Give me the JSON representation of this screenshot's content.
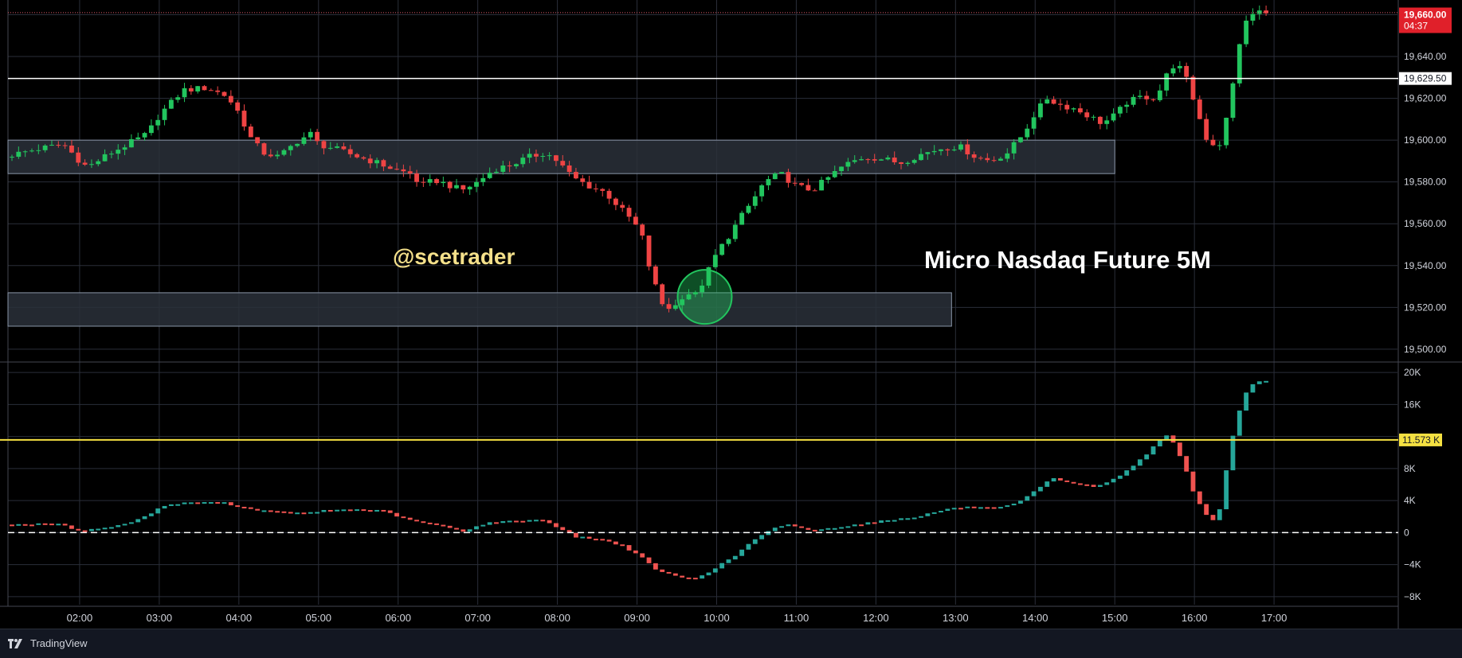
{
  "app": {
    "brand": "TradingView",
    "logo_icon": "tradingview-logo-icon"
  },
  "colors": {
    "background": "#000000",
    "grid": "#2a2e39",
    "up": "#22c55e",
    "down": "#ef4444",
    "vol_up": "#26a69a",
    "vol_down": "#ef5350",
    "zone_fill": "#2a3039",
    "zone_stroke": "#8a96a8",
    "white_line": "#ffffff",
    "yellow_line": "#f5e142",
    "price_badge": "#e0202a",
    "circle": "#22c55e",
    "watermark": "#f4e08a"
  },
  "chart_data": [
    {
      "type": "candlestick",
      "ylim": [
        19495,
        19664
      ],
      "y_ticks": [
        "19,660.00",
        "19,640.00",
        "19,620.00",
        "19,600.00",
        "19,580.00",
        "19,560.00",
        "19,540.00",
        "19,520.00",
        "19,500.00"
      ],
      "y_tick_values": [
        19660,
        19640,
        19620,
        19600,
        19580,
        19560,
        19540,
        19520,
        19500
      ],
      "x_ticks": [
        "02:00",
        "03:00",
        "04:00",
        "05:00",
        "06:00",
        "07:00",
        "08:00",
        "09:00",
        "10:00",
        "11:00",
        "12:00",
        "13:00",
        "14:00",
        "15:00",
        "16:00",
        "17:00"
      ],
      "x_tick_hours": [
        2,
        3,
        4,
        5,
        6,
        7,
        8,
        9,
        10,
        11,
        12,
        13,
        14,
        15,
        16,
        17
      ],
      "x_range_hours": [
        1.1,
        18.55
      ],
      "bar_minutes": 5,
      "close_path": [
        [
          1.15,
          19593
        ],
        [
          1.5,
          19596
        ],
        [
          1.8,
          19598
        ],
        [
          2.0,
          19590
        ],
        [
          2.1,
          19587
        ],
        [
          2.35,
          19593
        ],
        [
          2.6,
          19598
        ],
        [
          2.85,
          19603
        ],
        [
          3.0,
          19612
        ],
        [
          3.15,
          19618
        ],
        [
          3.3,
          19624
        ],
        [
          3.6,
          19625
        ],
        [
          3.85,
          19621
        ],
        [
          4.0,
          19613
        ],
        [
          4.15,
          19601
        ],
        [
          4.3,
          19594
        ],
        [
          4.5,
          19592
        ],
        [
          4.75,
          19600
        ],
        [
          4.9,
          19603
        ],
        [
          5.0,
          19598
        ],
        [
          5.2,
          19596
        ],
        [
          5.5,
          19592
        ],
        [
          5.75,
          19589
        ],
        [
          5.95,
          19586
        ],
        [
          6.15,
          19584
        ],
        [
          6.3,
          19578
        ],
        [
          6.45,
          19581
        ],
        [
          6.6,
          19579
        ],
        [
          6.8,
          19576
        ],
        [
          7.0,
          19580
        ],
        [
          7.2,
          19586
        ],
        [
          7.4,
          19588
        ],
        [
          7.65,
          19592
        ],
        [
          7.85,
          19594
        ],
        [
          8.0,
          19590
        ],
        [
          8.2,
          19582
        ],
        [
          8.4,
          19578
        ],
        [
          8.6,
          19575
        ],
        [
          8.75,
          19569
        ],
        [
          8.9,
          19563
        ],
        [
          9.05,
          19556
        ],
        [
          9.15,
          19540
        ],
        [
          9.3,
          19522
        ],
        [
          9.45,
          19519
        ],
        [
          9.6,
          19527
        ],
        [
          9.75,
          19526
        ],
        [
          9.85,
          19534
        ],
        [
          10.0,
          19546
        ],
        [
          10.15,
          19554
        ],
        [
          10.3,
          19563
        ],
        [
          10.45,
          19571
        ],
        [
          10.6,
          19580
        ],
        [
          10.8,
          19584
        ],
        [
          11.0,
          19578
        ],
        [
          11.2,
          19576
        ],
        [
          11.4,
          19582
        ],
        [
          11.6,
          19588
        ],
        [
          11.85,
          19592
        ],
        [
          12.1,
          19591
        ],
        [
          12.3,
          19589
        ],
        [
          12.55,
          19593
        ],
        [
          12.8,
          19596
        ],
        [
          13.05,
          19597
        ],
        [
          13.25,
          19592
        ],
        [
          13.45,
          19590
        ],
        [
          13.65,
          19594
        ],
        [
          13.85,
          19603
        ],
        [
          14.0,
          19613
        ],
        [
          14.15,
          19620
        ],
        [
          14.3,
          19617
        ],
        [
          14.5,
          19615
        ],
        [
          14.7,
          19611
        ],
        [
          14.85,
          19608
        ],
        [
          15.0,
          19612
        ],
        [
          15.15,
          19618
        ],
        [
          15.35,
          19621
        ],
        [
          15.5,
          19620
        ],
        [
          15.6,
          19626
        ],
        [
          15.7,
          19636
        ],
        [
          15.85,
          19634
        ],
        [
          15.95,
          19624
        ],
        [
          16.05,
          19612
        ],
        [
          16.15,
          19601
        ],
        [
          16.3,
          19596
        ],
        [
          16.4,
          19610
        ],
        [
          16.5,
          19630
        ],
        [
          16.58,
          19650
        ],
        [
          16.68,
          19659
        ],
        [
          16.8,
          19662
        ],
        [
          16.9,
          19660
        ]
      ],
      "zones": [
        {
          "from_hour": 1.1,
          "to_hour": 15.0,
          "low": 19584,
          "high": 19600
        },
        {
          "from_hour": 1.1,
          "to_hour": 12.95,
          "low": 19511,
          "high": 19527
        }
      ],
      "horizontal_lines": [
        {
          "value": 19629.5,
          "label": "19,629.50",
          "style": "solid"
        },
        {
          "value": 19661,
          "label": "",
          "style": "dotted"
        }
      ],
      "last_price": {
        "value": 19660,
        "label": "19,660.00",
        "countdown": "04:37"
      },
      "highlight_circle": {
        "hour": 9.85,
        "value": 19525
      },
      "annotations": [
        "@scetrader",
        "Micro Nasdaq Future 5M"
      ]
    },
    {
      "type": "bar",
      "ylim": [
        -9000,
        21000
      ],
      "y_ticks": [
        "20K",
        "16K",
        "",
        "8K",
        "4K",
        "0",
        "−4K",
        "−8K"
      ],
      "y_tick_values": [
        20000,
        16000,
        12000,
        8000,
        4000,
        0,
        -4000,
        -8000
      ],
      "zero_line": 0,
      "level_line": {
        "value": 11573,
        "label": "11.573 K"
      },
      "open_path": [
        [
          1.15,
          1000
        ],
        [
          1.8,
          1100
        ],
        [
          2.1,
          200
        ],
        [
          2.6,
          900
        ],
        [
          2.9,
          2000
        ],
        [
          3.15,
          3400
        ],
        [
          3.5,
          3800
        ],
        [
          3.9,
          3700
        ],
        [
          4.2,
          3000
        ],
        [
          4.5,
          2600
        ],
        [
          4.9,
          2400
        ],
        [
          5.2,
          2800
        ],
        [
          5.5,
          2900
        ],
        [
          5.9,
          2700
        ],
        [
          6.2,
          1600
        ],
        [
          6.6,
          900
        ],
        [
          6.9,
          200
        ],
        [
          7.2,
          1200
        ],
        [
          7.6,
          1500
        ],
        [
          7.9,
          1600
        ],
        [
          8.1,
          600
        ],
        [
          8.3,
          -500
        ],
        [
          8.6,
          -800
        ],
        [
          8.9,
          -1600
        ],
        [
          9.15,
          -3200
        ],
        [
          9.35,
          -4800
        ],
        [
          9.6,
          -5500
        ],
        [
          9.8,
          -5800
        ],
        [
          10.0,
          -4800
        ],
        [
          10.3,
          -3000
        ],
        [
          10.55,
          -900
        ],
        [
          10.8,
          500
        ],
        [
          11.0,
          1000
        ],
        [
          11.3,
          200
        ],
        [
          11.6,
          700
        ],
        [
          11.9,
          1100
        ],
        [
          12.2,
          1500
        ],
        [
          12.6,
          2000
        ],
        [
          13.0,
          3000
        ],
        [
          13.3,
          3200
        ],
        [
          13.6,
          3000
        ],
        [
          13.85,
          3600
        ],
        [
          14.1,
          5300
        ],
        [
          14.3,
          6800
        ],
        [
          14.55,
          6200
        ],
        [
          14.85,
          5700
        ],
        [
          15.0,
          6300
        ],
        [
          15.25,
          7800
        ],
        [
          15.5,
          10000
        ],
        [
          15.7,
          12300
        ],
        [
          15.8,
          11500
        ],
        [
          15.95,
          8500
        ],
        [
          16.1,
          4300
        ],
        [
          16.3,
          1200
        ],
        [
          16.4,
          3000
        ],
        [
          16.55,
          11573
        ],
        [
          16.7,
          17000
        ],
        [
          16.85,
          19000
        ],
        [
          16.95,
          18900
        ]
      ]
    }
  ]
}
